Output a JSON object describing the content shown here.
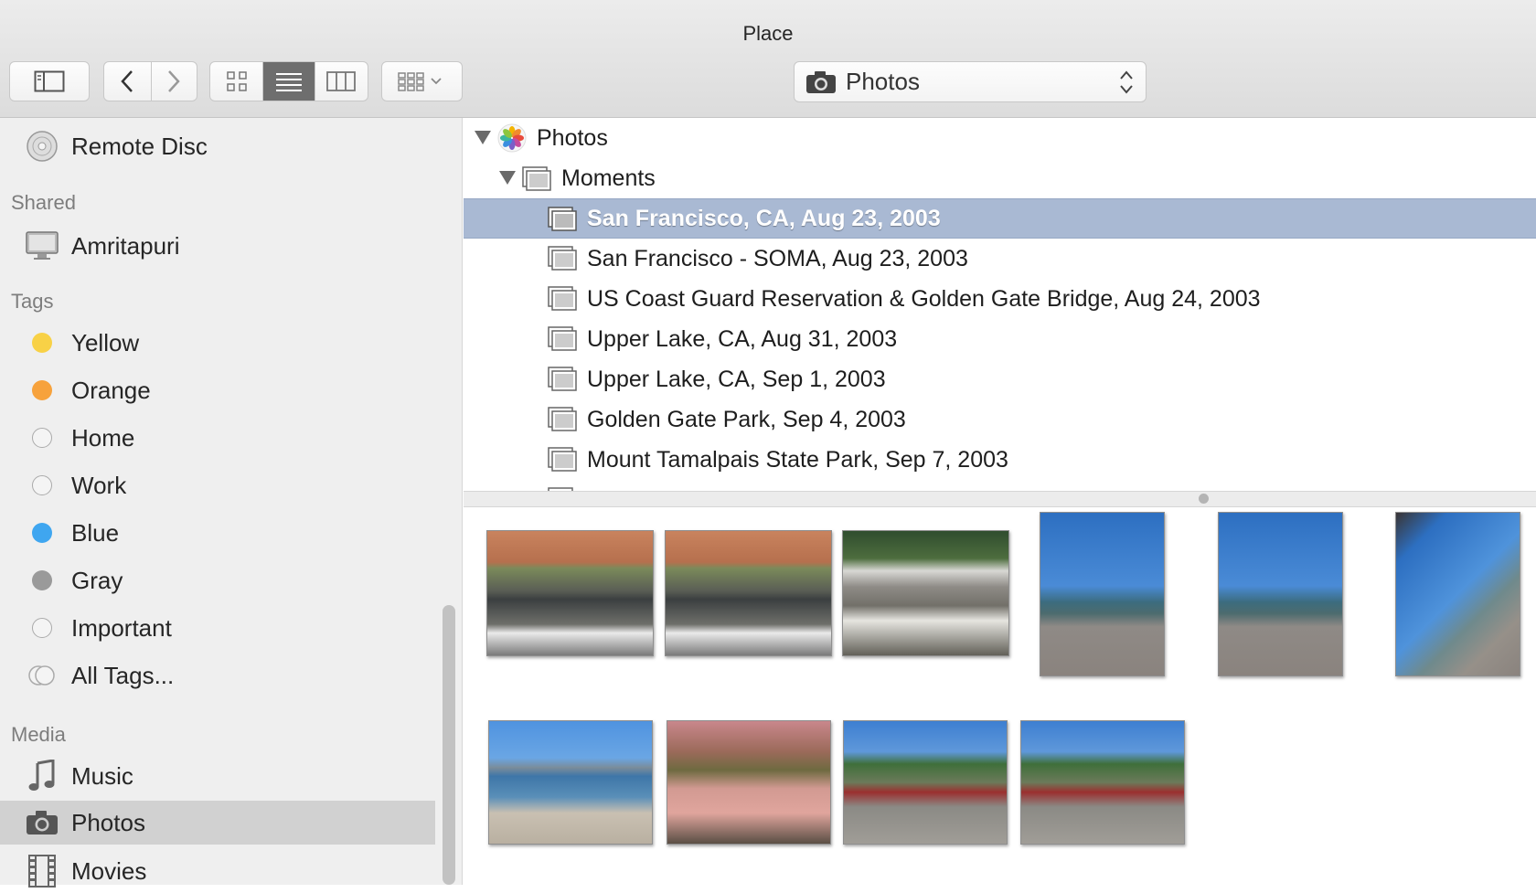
{
  "window": {
    "title": "Place"
  },
  "toolbar": {
    "source_popup": {
      "label": "Photos"
    }
  },
  "sidebar": {
    "top_items": [
      {
        "label": "Remote Disc",
        "icon": "disc-icon"
      }
    ],
    "shared_header": "Shared",
    "shared": [
      {
        "label": "Amritapuri",
        "icon": "computer-icon"
      }
    ],
    "tags_header": "Tags",
    "tags": [
      {
        "label": "Yellow",
        "color": "#f8d146"
      },
      {
        "label": "Orange",
        "color": "#f7a23c"
      },
      {
        "label": "Home",
        "color": ""
      },
      {
        "label": "Work",
        "color": ""
      },
      {
        "label": "Blue",
        "color": "#3fa6f0"
      },
      {
        "label": "Gray",
        "color": "#9a9a9a"
      },
      {
        "label": "Important",
        "color": ""
      },
      {
        "label": "All Tags...",
        "color": ""
      }
    ],
    "media_header": "Media",
    "media": [
      {
        "label": "Music",
        "icon": "music-note-icon"
      },
      {
        "label": "Photos",
        "icon": "camera-icon",
        "selected": true
      },
      {
        "label": "Movies",
        "icon": "film-icon"
      }
    ]
  },
  "browser": {
    "root": "Photos",
    "group": "Moments",
    "moments": [
      {
        "label": "San Francisco, CA, Aug 23, 2003",
        "selected": true
      },
      {
        "label": "San Francisco - SOMA, Aug 23, 2003"
      },
      {
        "label": "US Coast Guard Reservation & Golden Gate Bridge, Aug 24, 2003"
      },
      {
        "label": "Upper Lake, CA, Aug 31, 2003"
      },
      {
        "label": "Upper Lake, CA, Sep 1, 2003"
      },
      {
        "label": "Golden Gate Park, Sep 4, 2003"
      },
      {
        "label": "Mount Tamalpais State Park, Sep 7, 2003"
      }
    ]
  },
  "thumbnails": [
    {
      "name": "photo-cafe-table-1"
    },
    {
      "name": "photo-cafe-table-2"
    },
    {
      "name": "photo-parking-meter"
    },
    {
      "name": "photo-pier-ship-1"
    },
    {
      "name": "photo-pier-ship-2"
    },
    {
      "name": "photo-tall-ship"
    },
    {
      "name": "photo-beach"
    },
    {
      "name": "photo-patio"
    },
    {
      "name": "photo-kiosk-1"
    },
    {
      "name": "photo-kiosk-2"
    }
  ]
}
